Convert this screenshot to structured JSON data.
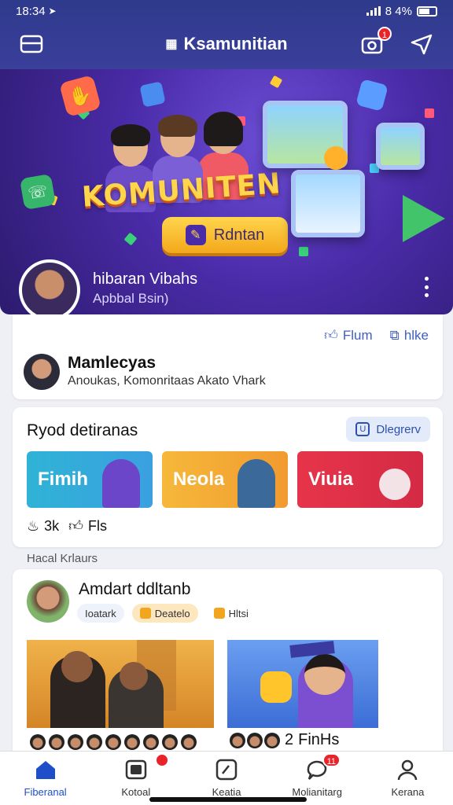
{
  "status_bar": {
    "time": "18:34",
    "battery": "8 4%"
  },
  "header": {
    "title": "Ksamunitian",
    "notification_count": "1"
  },
  "banner": {
    "headline": "KOMUNITEN",
    "cta_label": "Rdntan",
    "profile_name": "hibaran Vibahs",
    "profile_sub": "Apbbal Bsin)"
  },
  "post_card": {
    "action_1": "Flum",
    "action_2": "hlke",
    "author": "Mamlecyas",
    "subtitle": "Anoukas, Komonritaas Akato Vhark"
  },
  "featured": {
    "title": "Ryod detiranas",
    "pill_label": "Dlegrerv",
    "tiles": [
      "Fimih",
      "Neola",
      "Viuia"
    ],
    "stats_count": "3k",
    "stats_label": "Fls"
  },
  "section_label": "Hacal Krlaurs",
  "feed_item": {
    "author": "Amdart ddltanb",
    "chips": [
      "Ioatark",
      "Deatelo",
      "Hltsi"
    ],
    "tail_label": "FinHs",
    "tail_prefix": "2"
  },
  "bottom_nav": [
    {
      "label": "Fiberanal",
      "icon": "home-icon"
    },
    {
      "label": "Kotoal",
      "icon": "gallery-icon",
      "badge": ""
    },
    {
      "label": "Keatia",
      "icon": "edit-icon"
    },
    {
      "label": "Molianitarg",
      "icon": "chat-icon",
      "badge": "11"
    },
    {
      "label": "Kerana",
      "icon": "profile-icon"
    }
  ],
  "colors": {
    "header": "#2e3a8c",
    "accent": "#1e4fc9",
    "badge": "#e8232a",
    "cta": "#ffd64d"
  }
}
